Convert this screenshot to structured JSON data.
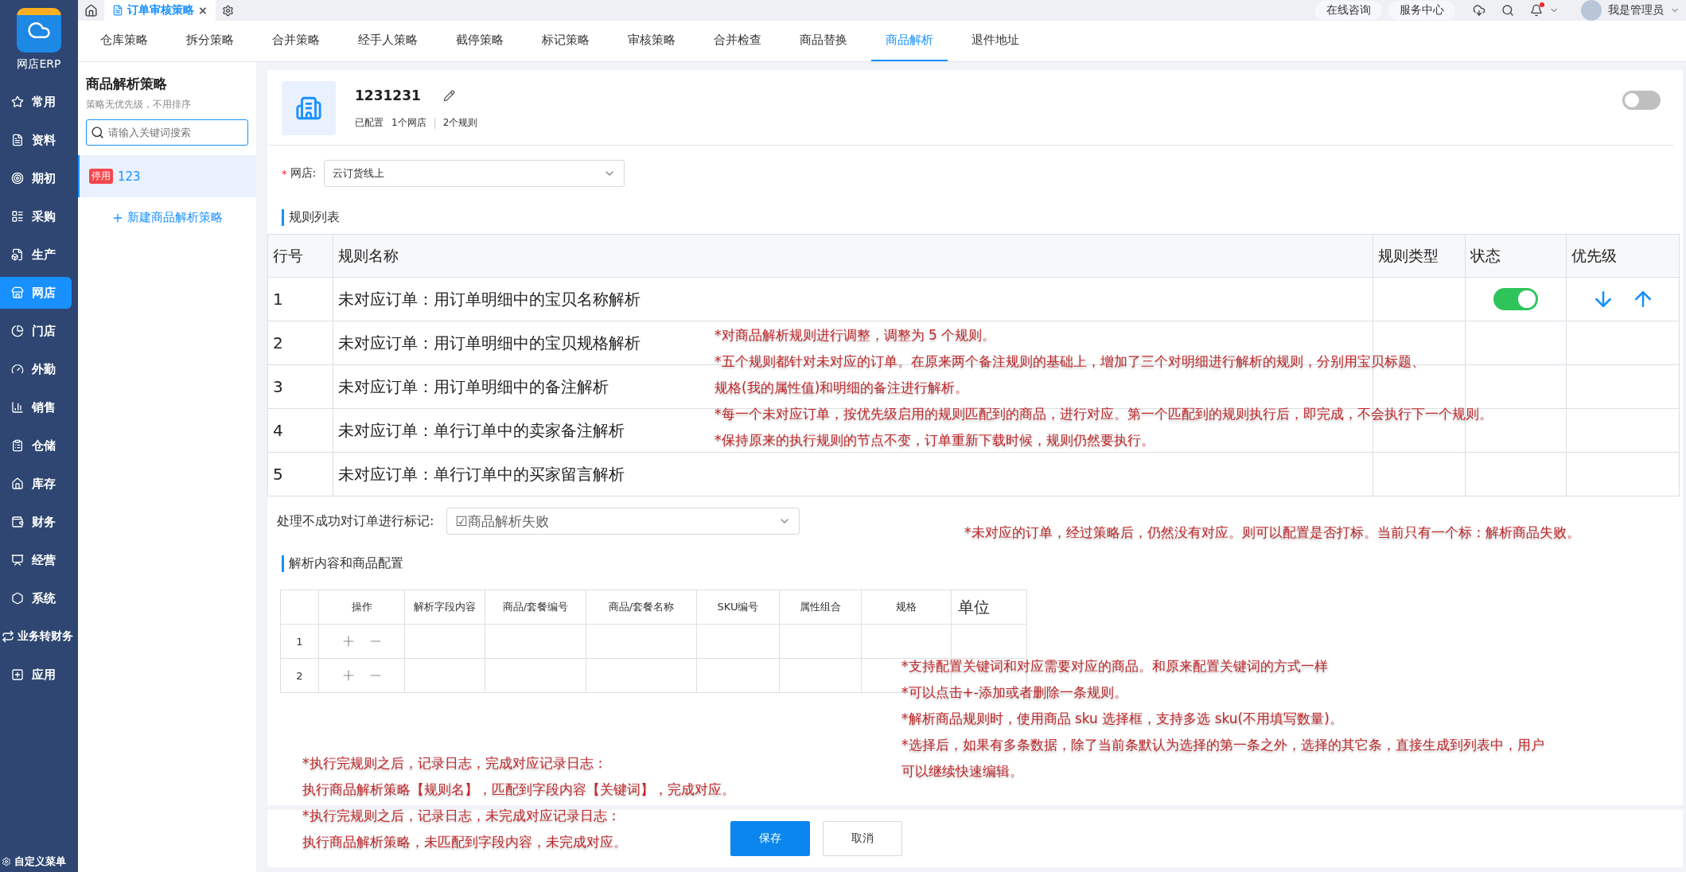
{
  "nav": {
    "brand": "网店ERP",
    "items": [
      {
        "label": "常用",
        "selected": false
      },
      {
        "label": "资料",
        "selected": false
      },
      {
        "label": "期初",
        "selected": false
      },
      {
        "label": "采购",
        "selected": false
      },
      {
        "label": "生产",
        "selected": false
      },
      {
        "label": "网店",
        "selected": true
      },
      {
        "label": "门店",
        "selected": false
      },
      {
        "label": "外勤",
        "selected": false
      },
      {
        "label": "销售",
        "selected": false
      },
      {
        "label": "仓储",
        "selected": false
      },
      {
        "label": "库存",
        "selected": false
      },
      {
        "label": "财务",
        "selected": false
      },
      {
        "label": "经营",
        "selected": false
      },
      {
        "label": "系统",
        "selected": false
      },
      {
        "label": "业务转财务",
        "selected": false
      },
      {
        "label": "应用",
        "selected": false
      }
    ],
    "footer": "自定义菜单"
  },
  "top_bar": {
    "page_tab": {
      "label": "订单审核策略",
      "close": "×"
    },
    "buttons": [
      "在线咨询",
      "服务中心"
    ],
    "notification_dot": true,
    "user": "我是管理员"
  },
  "strategy_tabs": [
    {
      "label": "仓库策略",
      "selected": false
    },
    {
      "label": "拆分策略",
      "selected": false
    },
    {
      "label": "合并策略",
      "selected": false
    },
    {
      "label": "经手人策略",
      "selected": false
    },
    {
      "label": "截停策略",
      "selected": false
    },
    {
      "label": "标记策略",
      "selected": false
    },
    {
      "label": "审核策略",
      "selected": false
    },
    {
      "label": "合并检查",
      "selected": false
    },
    {
      "label": "商品替换",
      "selected": false
    },
    {
      "label": "商品解析",
      "selected": true
    },
    {
      "label": "退件地址",
      "selected": false
    }
  ],
  "strategy_list": {
    "title": "商品解析策略",
    "subtitle": "策略无优先级，不用排序",
    "search": {
      "placeholder": "请输入关键词搜索"
    },
    "items": [
      {
        "tag": "停用",
        "name": "123",
        "selected": true
      }
    ],
    "add_link": "新建商品解析策略"
  },
  "strategy": {
    "name": "1231231",
    "meta": [
      "已配置",
      "1个网店",
      "2个规则"
    ],
    "on": false,
    "store": {
      "label": "网店:",
      "required_mark": "*",
      "value": "云订货线上"
    },
    "rules_title": "规则列表",
    "rules_table": {
      "columns": [
        "行号",
        "规则名称",
        "规则类型",
        "状态",
        "优先级"
      ],
      "rows": [
        {
          "no": "1",
          "name": "未对应订单：用订单明细中的宝贝名称解析",
          "kind": "editing",
          "enabled": true
        },
        {
          "no": "2",
          "name": "未对应订单：用订单明细中的宝贝规格解析",
          "kind": "plain"
        },
        {
          "no": "3",
          "name": "未对应订单：用订单明细中的备注解析",
          "kind": "plain"
        },
        {
          "no": "4",
          "name": "未对应订单：单行订单中的卖家备注解析",
          "kind": "plain"
        },
        {
          "no": "5",
          "name": "未对应订单：单行订单中的买家留言解析",
          "kind": "plain"
        }
      ]
    },
    "mark": {
      "label": "处理不成功对订单进行标记:",
      "value": "☑商品解析失败"
    },
    "config_title": "解析内容和商品配置",
    "config_table": {
      "columns": [
        "操作",
        "解析字段内容",
        "商品/套餐编号",
        "商品/套餐名称",
        "SKU编号",
        "属性组合",
        "规格",
        "单位"
      ],
      "rows": [
        "1",
        "2"
      ]
    }
  },
  "buttons": [
    {
      "label": "保存",
      "kind": "primary"
    },
    {
      "label": "取消",
      "kind": "default"
    }
  ],
  "notes": [
    {
      "lines": [
        "*对商品解析规则进行调整，调整为 5 个规则。",
        "*五个规则都针对未对应的订单。在原来两个备注规则的基础上，增加了三个对明细进行解析的规则，分别用宝贝标题、",
        "规格(我的属性值)和明细的备注进行解析。",
        "*每一个未对应订单，按优先级启用的规则匹配到的商品，进行对应。第一个匹配到的规则执行后，即完成，不会执行下一个规则。",
        "*保持原来的执行规则的节点不变，订单重新下载时候，规则仍然要执行。"
      ]
    },
    {
      "lines": [
        "*未对应的订单，经过策略后，仍然没有对应。则可以配置是否打标。当前只有一个标：解析商品失败。"
      ]
    },
    {
      "lines": [
        "*支持配置关键词和对应需要对应的商品。和原来配置关键词的方式一样",
        "*可以点击+-添加或者删除一条规则。",
        "*解析商品规则时，使用商品 sku 选择框，支持多选 sku(不用填写数量)。",
        "*选择后，如果有多条数据，除了当前条默认为选择的第一条之外，选择的其它条，直接生成到列表中，用户",
        "可以继续快速编辑。"
      ]
    },
    {
      "lines": [
        "*执行完规则之后，记录日志，完成对应记录日志：",
        "执行商品解析策略【规则名】，匹配到字段内容【关键词】，完成对应。",
        "*执行完规则之后，记录日志，未完成对应记录日志：",
        "执行商品解析策略，未匹配到字段内容，未完成对应。"
      ]
    }
  ]
}
